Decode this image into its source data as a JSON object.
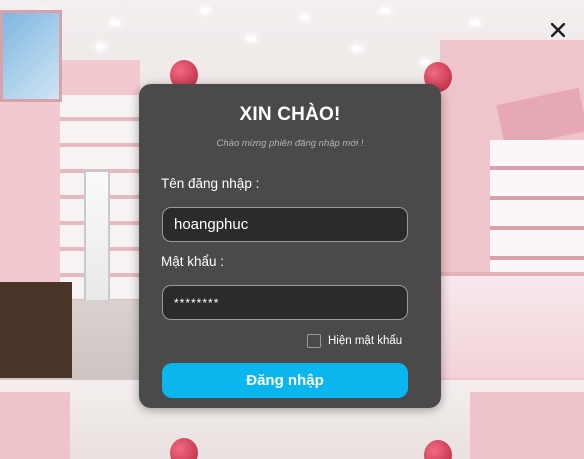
{
  "window": {
    "close_icon": "close-icon"
  },
  "login": {
    "title": "XIN CHÀO!",
    "subtitle": "Chào mừng phiên đăng nhập mới !",
    "username_label": "Tên đăng nhập :",
    "username_value": "hoangphuc",
    "password_label": "Mật khẩu :",
    "password_value": "********",
    "show_password_label": "Hiện mật khẩu",
    "show_password_checked": false,
    "submit_label": "Đăng nhập"
  },
  "colors": {
    "modal_bg": "#4a4a4a",
    "input_bg": "#2b2b2b",
    "button_bg": "#0bb5ee",
    "text": "#ffffff",
    "subtitle_text": "#b4b4b4"
  }
}
